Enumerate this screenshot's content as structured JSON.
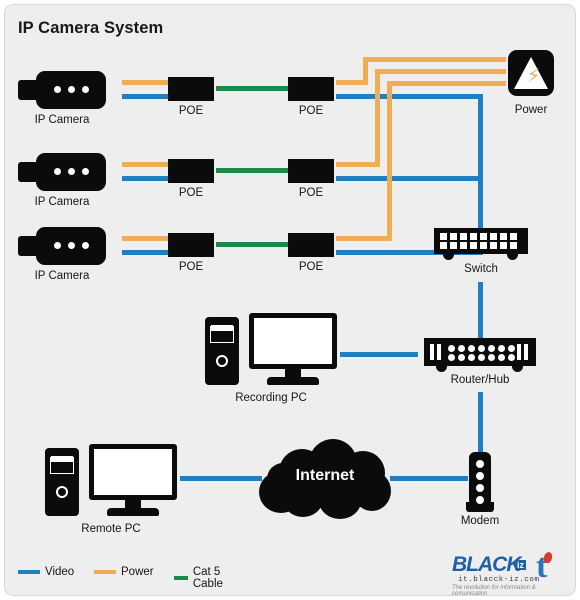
{
  "diagram": {
    "title": "IP Camera System",
    "background_color": "#eeeeee",
    "colors": {
      "video_blue": "#1f7fc0",
      "power_orange": "#efae56",
      "cat5_green": "#1a8a4a",
      "device_black": "#0b0b0c"
    }
  },
  "cameras": [
    {
      "label": "IP Camera"
    },
    {
      "label": "IP Camera"
    },
    {
      "label": "IP Camera"
    }
  ],
  "poe_units": [
    {
      "label": "POE"
    },
    {
      "label": "POE"
    },
    {
      "label": "POE"
    },
    {
      "label": "POE"
    },
    {
      "label": "POE"
    },
    {
      "label": "POE"
    }
  ],
  "devices": {
    "power": {
      "label": "Power",
      "icon": "lightning-bolt-icon",
      "glyph": "⚡"
    },
    "switch": {
      "label": "Switch",
      "ports_per_row": 9,
      "rows": 2
    },
    "router": {
      "label": "Router/Hub",
      "leds_per_row": 9,
      "rows": 2
    },
    "modem": {
      "label": "Modem",
      "leds": 4
    },
    "recording_pc": {
      "label": "Recording PC"
    },
    "remote_pc": {
      "label": "Remote PC"
    },
    "internet": {
      "label": "Internet"
    }
  },
  "legend": {
    "items": [
      {
        "label": "Video",
        "color": "#1f7fc0"
      },
      {
        "label": "Power",
        "color": "#efae56"
      },
      {
        "label": "Cat 5 Cable",
        "color": "#1a8a4a"
      }
    ]
  },
  "logo": {
    "mark": "BLACK",
    "badge": "iz",
    "letter": "t",
    "url": "it.blacck-iz.com",
    "tagline": "The revolution for information & comunication"
  }
}
